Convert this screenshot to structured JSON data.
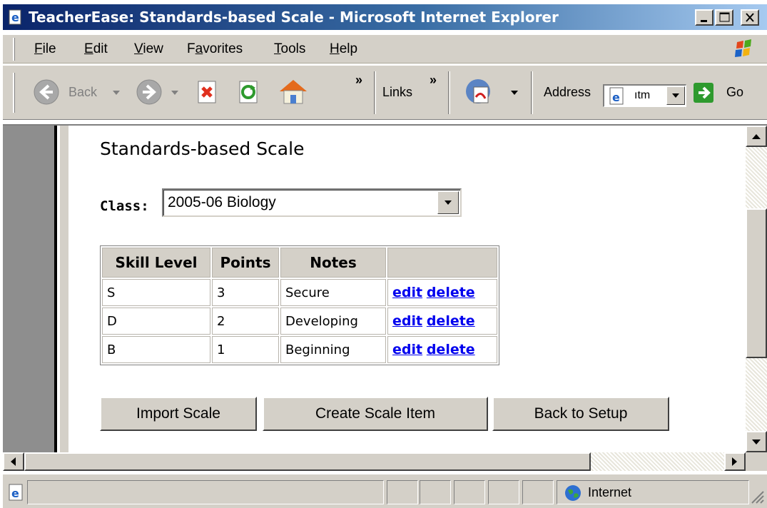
{
  "window": {
    "title": "TeacherEase: Standards-based Scale - Microsoft Internet Explorer",
    "controls": {
      "minimize": "minimize",
      "maximize": "maximize",
      "close": "close"
    }
  },
  "menu": [
    {
      "label": "File"
    },
    {
      "label": "Edit"
    },
    {
      "label": "View"
    },
    {
      "label": "Favorites"
    },
    {
      "label": "Tools"
    },
    {
      "label": "Help"
    }
  ],
  "toolbar": {
    "back_label": "Back",
    "chevron": "»",
    "links_label": "Links",
    "address_label": "Address",
    "address_value": "ıtm",
    "go_label": "Go"
  },
  "page": {
    "heading": "Standards-based Scale",
    "class_label": "Class:",
    "class_selected": "2005-06 Biology",
    "table": {
      "headers": [
        "Skill Level",
        "Points",
        "Notes",
        ""
      ],
      "rows": [
        {
          "skill": "S",
          "points": "3",
          "notes": "Secure",
          "edit": "edit",
          "delete": "delete"
        },
        {
          "skill": "D",
          "points": "2",
          "notes": "Developing",
          "edit": "edit",
          "delete": "delete"
        },
        {
          "skill": "B",
          "points": "1",
          "notes": "Beginning",
          "edit": "edit",
          "delete": "delete"
        }
      ]
    },
    "buttons": {
      "import": "Import Scale",
      "create": "Create Scale Item",
      "back": "Back to Setup"
    }
  },
  "status": {
    "zone": "Internet"
  },
  "colors": {
    "title_gradient_start": "#0a246a",
    "title_gradient_end": "#a6caf0",
    "chrome": "#d4d0c8",
    "link": "#0000ee"
  }
}
